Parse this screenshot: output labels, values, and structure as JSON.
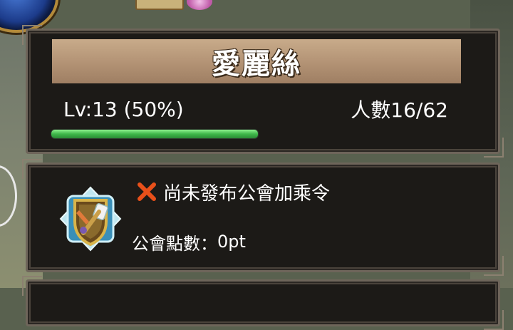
{
  "guild": {
    "name": "愛麗絲",
    "level_text": "Lv:13 (50%)",
    "progress": 1.0,
    "members_text": "人數16/62"
  },
  "bonus": {
    "status_text": "尚未發布公會加乘令"
  },
  "points": {
    "label": "公會點數：",
    "value": "0pt"
  },
  "icons": {
    "status": "cross-mark-icon",
    "emblem": "guild-emblem-icon"
  },
  "colors": {
    "progress": "#3fb84a",
    "cross": "#e8501a"
  }
}
